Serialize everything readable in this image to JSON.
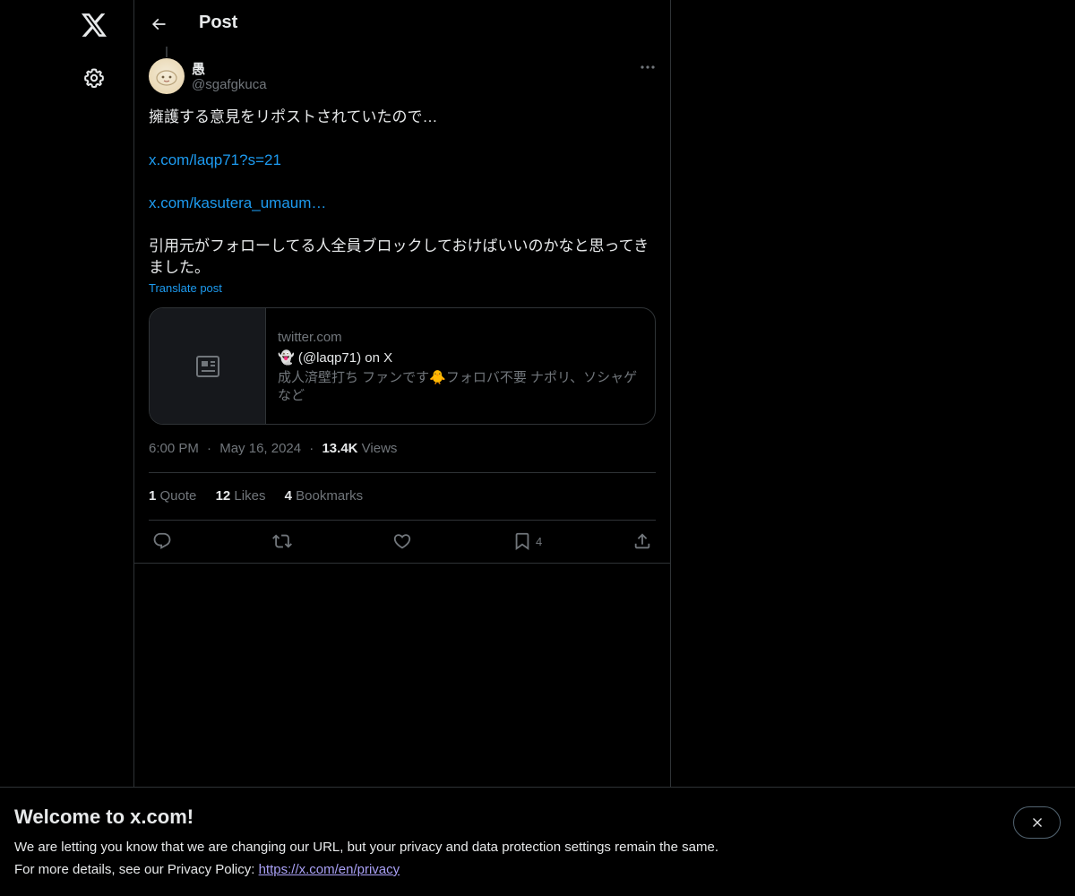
{
  "nav": {
    "logo_icon": "x-logo-icon",
    "settings_icon": "gear-icon"
  },
  "header": {
    "back_icon": "arrow-left-icon",
    "title": "Post"
  },
  "post": {
    "author_name": "愚",
    "author_handle": "@sgafgkuca",
    "body_line1": "擁護する意見をリポストされていたので…",
    "link1": "x.com/laqp71?s=21",
    "link2": "x.com/kasutera_umaum…",
    "body_line2": "引用元がフォローしてる人全員ブロックしておけばいいのかなと思ってき",
    "body_line3": "ました。",
    "translate_label": "Translate post",
    "time": "6:00 PM",
    "date": "May 16, 2024",
    "views_count": "13.4K",
    "views_label": "Views",
    "separator": "·"
  },
  "card": {
    "thumb_icon": "article-icon",
    "domain": "twitter.com",
    "title": "👻 (@laqp71) on X",
    "description": "成人済壁打ち ファンです🐥フォロバ不要 ナポリ、ソシャゲなど"
  },
  "stats": [
    {
      "count": "1",
      "label": "Quote"
    },
    {
      "count": "12",
      "label": "Likes"
    },
    {
      "count": "4",
      "label": "Bookmarks"
    }
  ],
  "actions": {
    "reply_icon": "reply-icon",
    "repost_icon": "repost-icon",
    "like_icon": "heart-icon",
    "bookmark_icon": "bookmark-icon",
    "bookmark_count": "4",
    "share_icon": "share-icon"
  },
  "banner": {
    "title": "Welcome to x.com!",
    "text1": "We are letting you know that we are changing our URL, but your privacy and data protection settings remain the same.",
    "text2_prefix": "For more details, see our Privacy Policy: ",
    "privacy_link": "https://x.com/en/privacy",
    "close_icon": "close-icon"
  },
  "colors": {
    "background": "#000000",
    "text_primary": "#e7e9ea",
    "text_secondary": "#71767b",
    "link": "#1d9bf0",
    "border": "#2f3336",
    "banner_link": "#a9a0f5"
  }
}
